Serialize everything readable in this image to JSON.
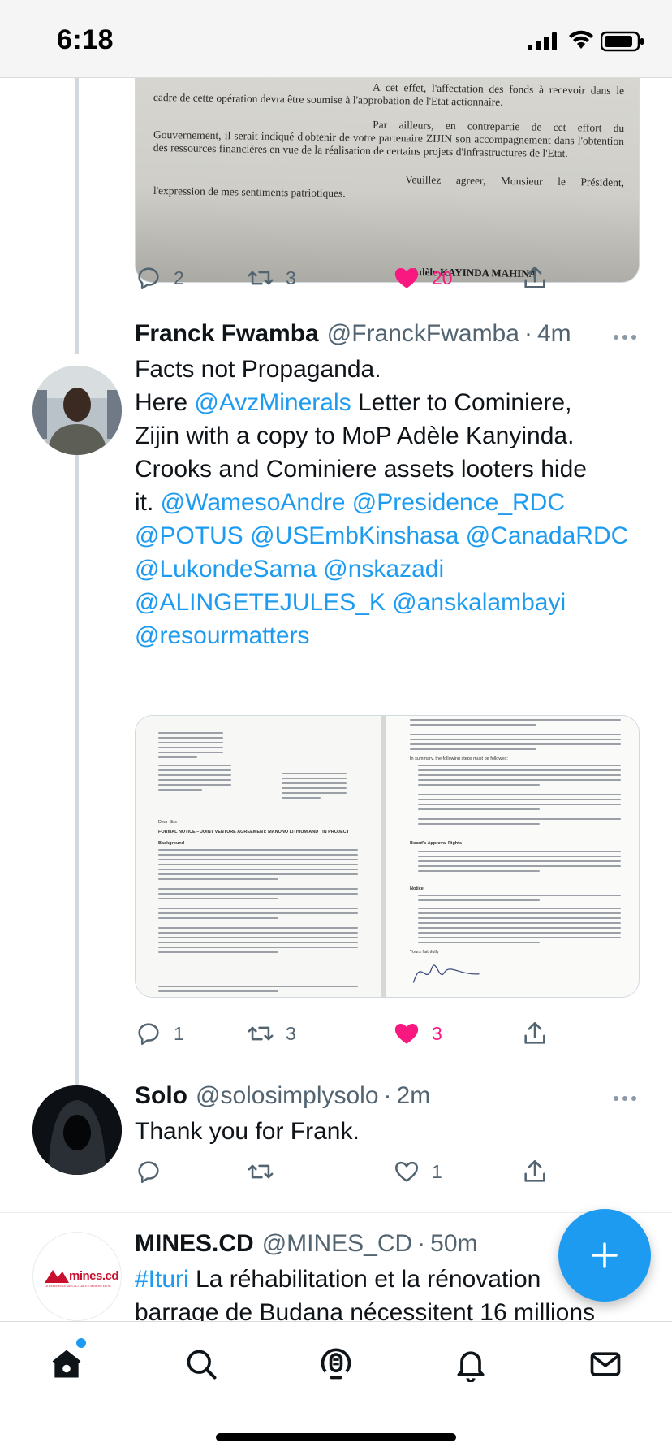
{
  "status_bar": {
    "time": "6:18"
  },
  "tweet0": {
    "image_text": {
      "p1": "A cet effet, l'affectation des fonds à recevoir dans le cadre de cette opération devra être soumise à l'approbation de l'Etat actionnaire.",
      "p2": "Par ailleurs, en contrepartie de cet effort du Gouvernement, il serait indiqué d'obtenir de votre partenaire ZIJIN son accompagnement dans l'obtention des ressources financières en vue de la réalisation de certains projets d'infrastructures de l'Etat.",
      "p3": "Veuillez agreer, Monsieur le Président, l'expression de mes sentiments patriotiques.",
      "signature": "Adèle KAYINDA MAHINA"
    },
    "replies": "2",
    "retweets": "3",
    "likes": "20"
  },
  "tweet1": {
    "display_name": "Franck Fwamba",
    "handle": "@FranckFwamba",
    "time": "4m",
    "line1": "Facts not Propaganda.",
    "line2_a": "Here ",
    "line2_mention": "@AvzMinerals",
    "line2_b": " Letter to Cominiere,",
    "line3": "Zijin with a copy to MoP Adèle Kanyinda.",
    "line4": "Crooks and Cominiere assets looters hide",
    "line5_a": "it. ",
    "mentions": [
      "@WamesoAndre",
      "@Presidence_RDC",
      "@POTUS",
      "@USEmbKinshasa",
      "@CanadaRDC",
      "@LukondeSama",
      "@nskazadi",
      "@ALINGETEJULES_K",
      "@anskalambayi",
      "@resourmatters"
    ],
    "doc_left": {
      "heading": "FORMAL NOTICE – JOINT VENTURE AGREEMENT: MANONO LITHIUM AND TIN PROJECT",
      "salutation": "Dear Sirs",
      "background": "Background"
    },
    "doc_right": {
      "steps": "In summary, the following steps must be followed:",
      "approval": "Board's Approval Rights",
      "notice": "Notice",
      "closing": "Yours faithfully"
    },
    "replies": "1",
    "retweets": "3",
    "likes": "3"
  },
  "tweet2": {
    "display_name": "Solo",
    "handle": "@solosimplysolo",
    "time": "2m",
    "text": "Thank you for Frank.",
    "likes": "1"
  },
  "tweet3": {
    "display_name": "MINES.CD",
    "handle": "@MINES_CD",
    "time": "50m",
    "avatar_text": "mines.cd",
    "avatar_tagline": "LA RÉFÉRENCE DE L'ACTUALITÉ MINIÈRE EN RDC",
    "hashtag": "#Ituri",
    "line1": " La réhabilitation et la rénovation",
    "line2": "barrage de Budana nécessitent 16 millions"
  },
  "colors": {
    "accent": "#1d9bf0",
    "like": "#f91880",
    "muted": "#536471"
  }
}
